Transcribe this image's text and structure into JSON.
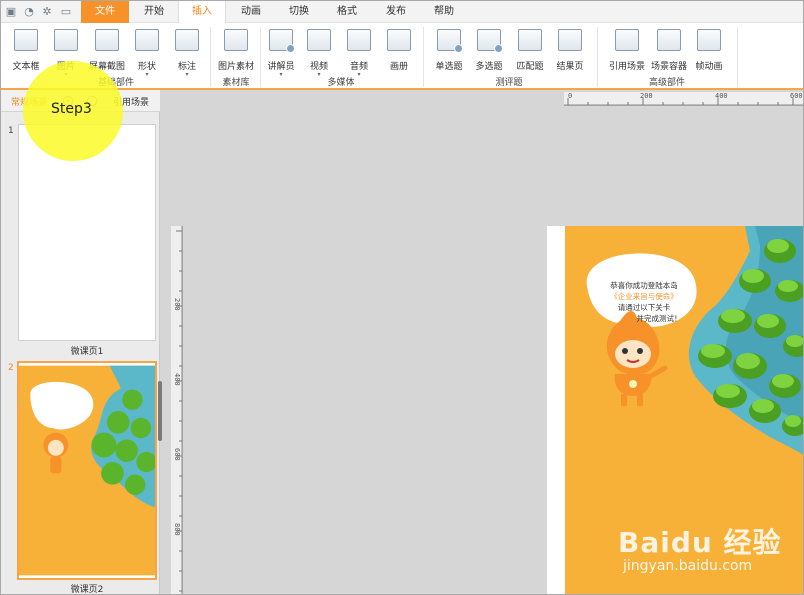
{
  "quick_access": [
    "save-icon",
    "undo-icon",
    "settings-icon",
    "present-icon"
  ],
  "menu_tabs": [
    {
      "label": "文件"
    },
    {
      "label": "开始"
    },
    {
      "label": "插入"
    },
    {
      "label": "动画"
    },
    {
      "label": "切换"
    },
    {
      "label": "格式"
    },
    {
      "label": "发布"
    },
    {
      "label": "帮助"
    }
  ],
  "ribbon": {
    "buttons": [
      {
        "label": "文本框"
      },
      {
        "label": "图片"
      },
      {
        "label": "屏幕截图"
      },
      {
        "label": "形状"
      },
      {
        "label": "标注"
      },
      {
        "label": "图片素材"
      },
      {
        "label": "讲解员"
      },
      {
        "label": "视频"
      },
      {
        "label": "音频"
      },
      {
        "label": "画册"
      },
      {
        "label": "单选题"
      },
      {
        "label": "多选题"
      },
      {
        "label": "匹配题"
      },
      {
        "label": "结果页"
      },
      {
        "label": "引用场景"
      },
      {
        "label": "场景容器"
      },
      {
        "label": "帧动画"
      }
    ],
    "groups": [
      {
        "label": "基础部件"
      },
      {
        "label": "素材库"
      },
      {
        "label": "多媒体"
      },
      {
        "label": "测评题"
      },
      {
        "label": "高级部件"
      }
    ]
  },
  "left_panel": {
    "tabs": {
      "normal": "常规场景",
      "reference": "引用场景"
    },
    "slides": [
      {
        "number": "1",
        "caption": "微课页1"
      },
      {
        "number": "2",
        "caption": "微课页2"
      }
    ]
  },
  "rulers": {
    "horizontal": [
      "0",
      "200",
      "400",
      "600"
    ],
    "vertical": [
      "200",
      "400",
      "600",
      "800"
    ]
  },
  "slide_content": {
    "speech_lines": [
      "恭喜你成功登陆本岛",
      "《企业来旨与使命》",
      "请通过以下关卡",
      "并完成测试！"
    ]
  },
  "overlay": {
    "step_label": "Step3"
  },
  "watermark": {
    "brand": "Baidu 经验",
    "url": "jingyan.baidu.com"
  },
  "colors": {
    "accent": "#f7922a",
    "slide_bg": "#f8b138",
    "water": "#5bb8c9",
    "island": "#5ab52c"
  }
}
